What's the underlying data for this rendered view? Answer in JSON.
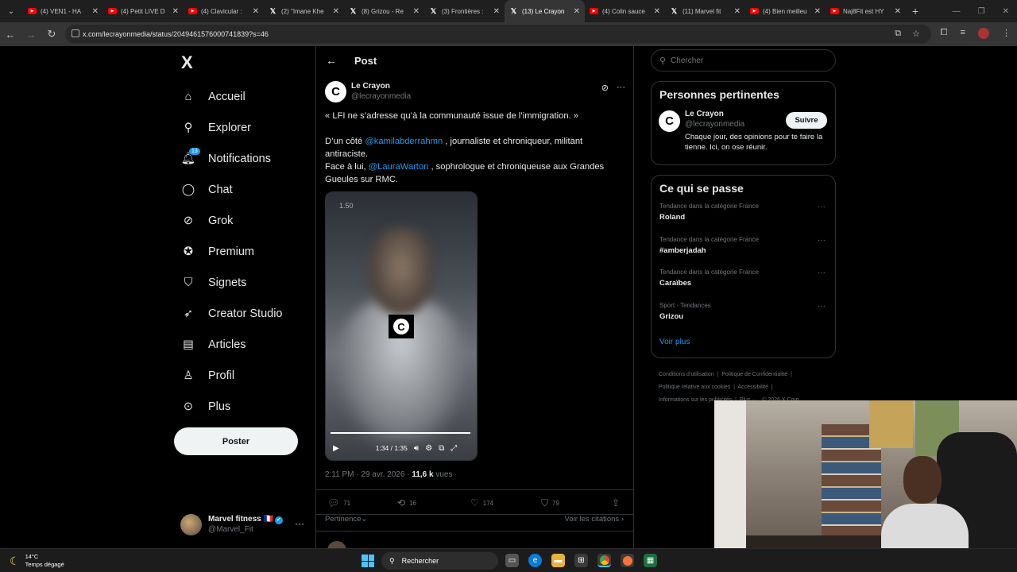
{
  "browser": {
    "tabs": [
      {
        "label": "(4) VEN1 - HA",
        "icon": "youtube-icon"
      },
      {
        "label": "(4) Petit LIVE D",
        "icon": "youtube-icon"
      },
      {
        "label": "(4) Clavicular :",
        "icon": "youtube-icon"
      },
      {
        "label": "(2) \"Imane Khe",
        "icon": "x-icon"
      },
      {
        "label": "(8) Grizou - Re",
        "icon": "x-icon"
      },
      {
        "label": "(3) Frontières :",
        "icon": "x-icon"
      },
      {
        "label": "(13) Le Crayon",
        "icon": "x-icon",
        "active": true
      },
      {
        "label": "(4) Colin sauce",
        "icon": "youtube-icon"
      },
      {
        "label": "(11) Marvel fit",
        "icon": "x-icon"
      },
      {
        "label": "(4) Bien meilleu",
        "icon": "youtube-icon"
      },
      {
        "label": "Naj8Fit est HY",
        "icon": "youtube-icon"
      }
    ],
    "url": "x.com/lecrayonmedia/status/2049461576000741839?s=46"
  },
  "sidebar": {
    "logo": "X",
    "items": [
      {
        "label": "Accueil",
        "icon": "home-icon"
      },
      {
        "label": "Explorer",
        "icon": "search-icon"
      },
      {
        "label": "Notifications",
        "icon": "bell-icon",
        "badge": "13"
      },
      {
        "label": "Chat",
        "icon": "chat-icon"
      },
      {
        "label": "Grok",
        "icon": "grok-icon"
      },
      {
        "label": "Premium",
        "icon": "premium-icon"
      },
      {
        "label": "Signets",
        "icon": "bookmark-icon"
      },
      {
        "label": "Creator Studio",
        "icon": "rocket-icon"
      },
      {
        "label": "Articles",
        "icon": "articles-icon"
      },
      {
        "label": "Profil",
        "icon": "profile-icon"
      },
      {
        "label": "Plus",
        "icon": "more-circle-icon"
      }
    ],
    "post_button": "Poster",
    "account": {
      "name": "Marvel fitness",
      "flag": "🇫🇷",
      "handle": "@Marvel_Fit"
    }
  },
  "post": {
    "header_title": "Post",
    "author": {
      "name": "Le Crayon",
      "handle": "@lecrayonmedia"
    },
    "text": {
      "line1": "« LFI ne s’adresse qu’à la communauté issue de l’immigration. »",
      "p2_prefix": "D’un côté ",
      "p2_mention": "@kamilabderrahmn",
      "p2_suffix": " , journaliste et chroniqueur, militant antiraciste.",
      "p3_prefix": "Face à lui, ",
      "p3_mention": "@LauraWarton",
      "p3_suffix": " , sophrologue et chroniqueuse aux Grandes Gueules sur RMC."
    },
    "video": {
      "speed": "1.50",
      "time": "1:34 / 1:35",
      "progress": 0.99
    },
    "time": "2:11 PM · 29 avr. 2026 · ",
    "views": "11,6 k",
    "views_label": " vues",
    "actions": {
      "replies": "71",
      "reposts": "16",
      "likes": "174",
      "bookmarks": "79"
    },
    "sort_label": "Pertinence",
    "citations_label": "Voir les citations"
  },
  "right": {
    "search_placeholder": "Chercher",
    "relevant": {
      "title": "Personnes pertinentes",
      "name": "Le Crayon",
      "handle": "@lecrayonmedia",
      "follow": "Suivre",
      "bio": "Chaque jour, des opinions pour te faire la tienne. Ici, on ose réunir."
    },
    "trends": {
      "title": "Ce qui se passe",
      "items": [
        {
          "category": "Tendance dans la catégorie France",
          "name": "Roland"
        },
        {
          "category": "Tendance dans la catégorie France",
          "name": "#amberjadah"
        },
        {
          "category": "Tendance dans la catégorie France",
          "name": "Caraïbes"
        },
        {
          "category": "Sport · Tendances",
          "name": "Grizou"
        }
      ],
      "see_more": "Voir plus"
    },
    "footer": {
      "l1": "Conditions d’utilisation",
      "l2": "Politique de Confidentialité",
      "l3": "Politique relative aux cookies",
      "l4": "Accessibilité",
      "l5": "Informations sur les publicités",
      "l6": "Plus ···",
      "l7": "© 2026 X Corp."
    }
  },
  "taskbar": {
    "temp": "14°C",
    "weather": "Temps dégagé",
    "search": "Rechercher"
  }
}
